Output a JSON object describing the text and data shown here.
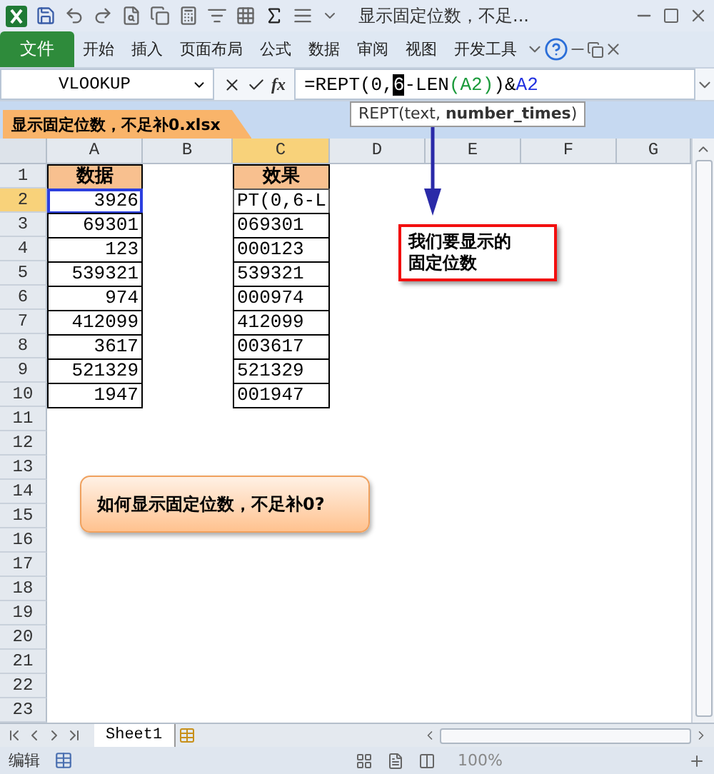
{
  "window": {
    "title": "显示固定位数，不足..."
  },
  "file_button": "文件",
  "ribbon_tabs": [
    "开始",
    "插入",
    "页面布局",
    "公式",
    "数据",
    "审阅",
    "视图",
    "开发工具"
  ],
  "formula_bar": {
    "name_box": "VLOOKUP",
    "function_label": "fx",
    "segments": [
      {
        "text": "=REPT(0,",
        "color": "#000000",
        "selected": false
      },
      {
        "text": "6",
        "color": "#000000",
        "selected": true
      },
      {
        "text": "-LEN",
        "color": "#000000",
        "selected": false
      },
      {
        "text": "(A2)",
        "color": "#1a9a3a",
        "selected": false
      },
      {
        "text": ")&",
        "color": "#000000",
        "selected": false
      },
      {
        "text": "A2",
        "color": "#2030e0",
        "selected": false
      }
    ]
  },
  "document_tab": "显示固定位数，不足补0.xlsx",
  "tooltip": "REPT(text, **number_times**)",
  "columns": [
    {
      "label": "A",
      "selected": false
    },
    {
      "label": "B",
      "selected": false
    },
    {
      "label": "C",
      "selected": true
    },
    {
      "label": "D",
      "selected": false
    },
    {
      "label": "E",
      "selected": false
    },
    {
      "label": "F",
      "selected": false
    },
    {
      "label": "G",
      "selected": false
    }
  ],
  "rows": [
    {
      "number": "1",
      "selected": false,
      "a": {
        "text": "数据",
        "kind": "header",
        "referenced": false
      },
      "c": {
        "text": "效果",
        "kind": "header",
        "editing": false
      }
    },
    {
      "number": "2",
      "selected": true,
      "a": {
        "text": "3926",
        "kind": "number",
        "referenced": true
      },
      "c": {
        "text": "PT(0,6-L",
        "kind": "text",
        "editing": true
      }
    },
    {
      "number": "3",
      "selected": false,
      "a": {
        "text": "69301",
        "kind": "number",
        "referenced": false
      },
      "c": {
        "text": "069301",
        "kind": "text",
        "editing": false
      }
    },
    {
      "number": "4",
      "selected": false,
      "a": {
        "text": "123",
        "kind": "number",
        "referenced": false
      },
      "c": {
        "text": "000123",
        "kind": "text",
        "editing": false
      }
    },
    {
      "number": "5",
      "selected": false,
      "a": {
        "text": "539321",
        "kind": "number",
        "referenced": false
      },
      "c": {
        "text": "539321",
        "kind": "text",
        "editing": false
      }
    },
    {
      "number": "6",
      "selected": false,
      "a": {
        "text": "974",
        "kind": "number",
        "referenced": false
      },
      "c": {
        "text": "000974",
        "kind": "text",
        "editing": false
      }
    },
    {
      "number": "7",
      "selected": false,
      "a": {
        "text": "412099",
        "kind": "number",
        "referenced": false
      },
      "c": {
        "text": "412099",
        "kind": "text",
        "editing": false
      }
    },
    {
      "number": "8",
      "selected": false,
      "a": {
        "text": "3617",
        "kind": "number",
        "referenced": false
      },
      "c": {
        "text": "003617",
        "kind": "text",
        "editing": false
      }
    },
    {
      "number": "9",
      "selected": false,
      "a": {
        "text": "521329",
        "kind": "number",
        "referenced": false
      },
      "c": {
        "text": "521329",
        "kind": "text",
        "editing": false
      }
    },
    {
      "number": "10",
      "selected": false,
      "a": {
        "text": "1947",
        "kind": "number",
        "referenced": false
      },
      "c": {
        "text": "001947",
        "kind": "text",
        "editing": false
      }
    },
    {
      "number": "11",
      "selected": false
    },
    {
      "number": "12",
      "selected": false
    },
    {
      "number": "13",
      "selected": false
    },
    {
      "number": "14",
      "selected": false
    },
    {
      "number": "15",
      "selected": false
    },
    {
      "number": "16",
      "selected": false
    },
    {
      "number": "17",
      "selected": false
    },
    {
      "number": "18",
      "selected": false
    },
    {
      "number": "19",
      "selected": false
    },
    {
      "number": "20",
      "selected": false
    },
    {
      "number": "21",
      "selected": false
    },
    {
      "number": "22",
      "selected": false
    },
    {
      "number": "23",
      "selected": false
    }
  ],
  "callout": "我们要显示的固定位数",
  "question_box": "如何显示固定位数，不足补0?",
  "sheet_tabs": [
    {
      "label": "Sheet1",
      "selected": true
    }
  ],
  "status_bar": {
    "mode": "编辑",
    "zoom": "100%"
  }
}
